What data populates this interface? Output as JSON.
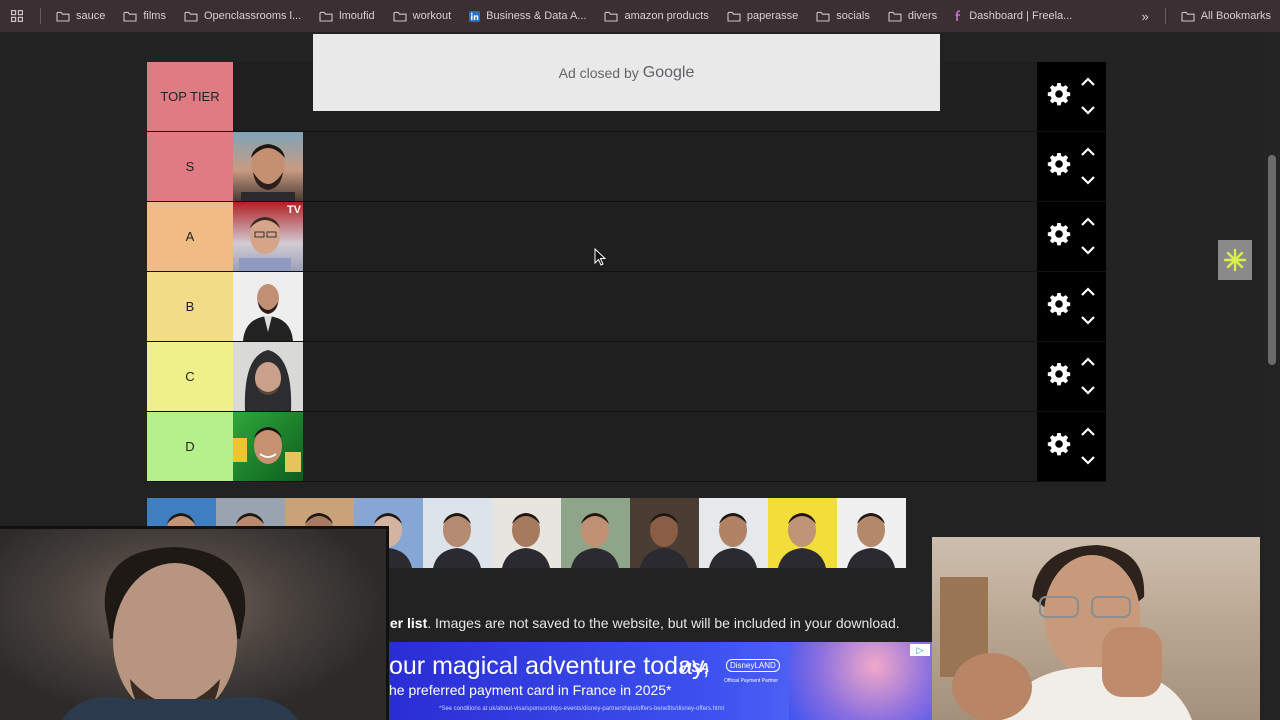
{
  "bookmarks": {
    "items": [
      {
        "label": "sauce",
        "icon": "folder-icon"
      },
      {
        "label": "films",
        "icon": "folder-icon"
      },
      {
        "label": "Openclassrooms l...",
        "icon": "folder-icon"
      },
      {
        "label": "lmoufid",
        "icon": "folder-icon"
      },
      {
        "label": "workout",
        "icon": "folder-icon"
      },
      {
        "label": "Business & Data A...",
        "icon": "linkedin-icon"
      },
      {
        "label": "amazon products",
        "icon": "folder-icon"
      },
      {
        "label": "paperasse",
        "icon": "folder-icon"
      },
      {
        "label": "socials",
        "icon": "folder-icon"
      },
      {
        "label": "divers",
        "icon": "folder-icon"
      },
      {
        "label": "Dashboard | Freela...",
        "icon": "freelance-icon"
      }
    ],
    "overflow": "»",
    "all_label": "All Bookmarks"
  },
  "ad_overlay": {
    "text": "Ad closed by",
    "brand": "Google"
  },
  "tiers": [
    {
      "label": "TOP TIER",
      "color": "#e07b83",
      "items": 0
    },
    {
      "label": "S",
      "color": "#e07b83",
      "items": 1
    },
    {
      "label": "A",
      "color": "#f1bb86",
      "items": 1
    },
    {
      "label": "B",
      "color": "#f3dc87",
      "items": 1
    },
    {
      "label": "C",
      "color": "#eef08a",
      "items": 1
    },
    {
      "label": "D",
      "color": "#b5f08a",
      "items": 1
    }
  ],
  "thumb_overlay_tv": "TV",
  "info": {
    "bold": "ier list",
    "rest": ". Images are not saved to the website, but will be included in your download."
  },
  "banner": {
    "line1": "our magical adventure today,",
    "line2": "he preferred payment card in France in 2025*",
    "fine": "*See conditions at\nuk/about-visa/sponsorships-events/disney-partnerships/offers-benefits/disney-offers.html",
    "visa": "VISA",
    "disney": "DisneyLAND",
    "partner": "Official Payment Partner",
    "adchoice": "▷"
  },
  "colors": {
    "accent_bar": "#3b2f34",
    "background": "#222222"
  }
}
